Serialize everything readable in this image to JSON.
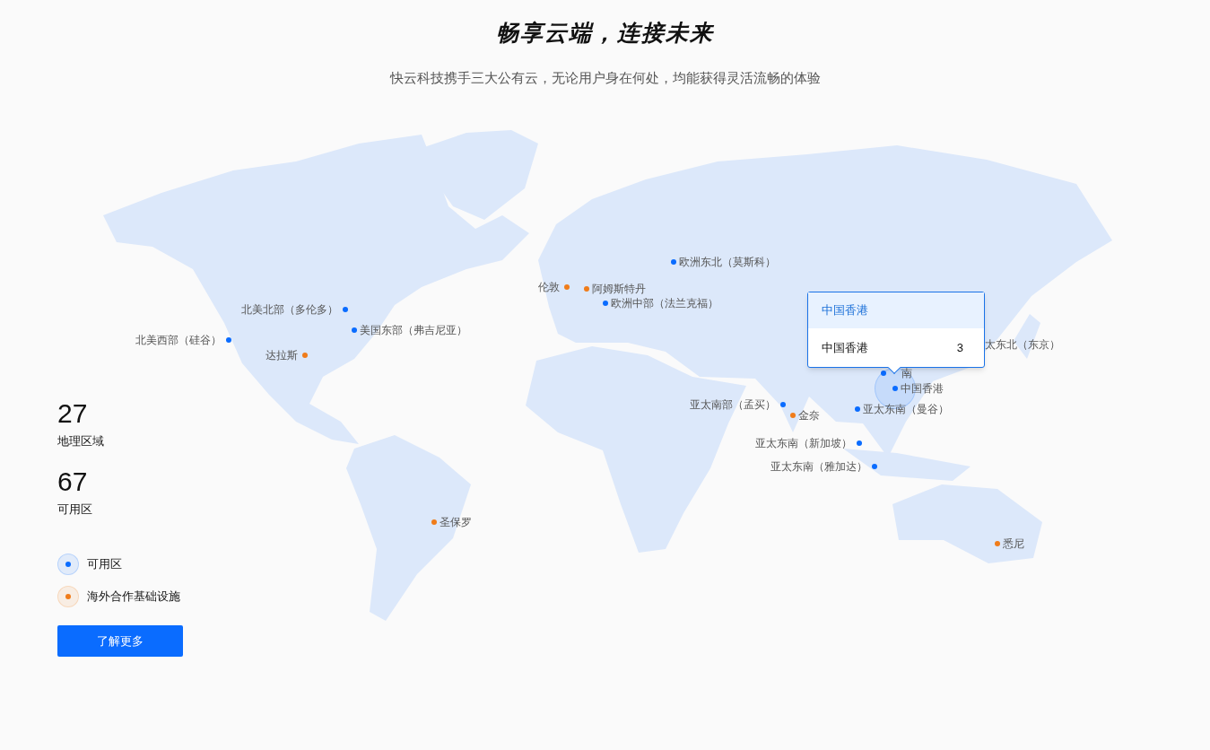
{
  "title": "畅享云端，连接未来",
  "subtitle": "快云科技携手三大公有云，无论用户身在何处，均能获得灵活流畅的体验",
  "stats": [
    {
      "value": "27",
      "label": "地理区域"
    },
    {
      "value": "67",
      "label": "可用区"
    }
  ],
  "legend": [
    {
      "label": "可用区",
      "color": "#0a6cff"
    },
    {
      "label": "海外合作基础设施",
      "color": "#f07c1a"
    }
  ],
  "button": "了解更多",
  "markers": [
    {
      "label": "欧洲东北（莫斯科）",
      "color": "#0a6cff"
    },
    {
      "label": "伦敦",
      "color": "#f07c1a"
    },
    {
      "label": "阿姆斯特丹",
      "color": "#f07c1a"
    },
    {
      "label": "欧洲中部（法兰克福）",
      "color": "#0a6cff"
    },
    {
      "label": "北美北部（多伦多）",
      "color": "#0a6cff"
    },
    {
      "label": "美国东部（弗吉尼亚）",
      "color": "#0a6cff"
    },
    {
      "label": "北美西部（硅谷）",
      "color": "#0a6cff"
    },
    {
      "label": "达拉斯",
      "color": "#f07c1a"
    },
    {
      "label": "太东北（东京）"
    },
    {
      "label": "南",
      "color": "#0a6cff"
    },
    {
      "label": "中国香港",
      "color": "#0a6cff",
      "selected": true
    },
    {
      "label": "亚太南部（孟买）",
      "color": "#0a6cff"
    },
    {
      "label": "金奈",
      "color": "#f07c1a"
    },
    {
      "label": "亚太东南（曼谷）",
      "color": "#0a6cff"
    },
    {
      "label": "亚太东南（新加坡）",
      "color": "#0a6cff"
    },
    {
      "label": "亚太东南（雅加达）",
      "color": "#0a6cff"
    },
    {
      "label": "圣保罗",
      "color": "#f07c1a"
    },
    {
      "label": "悉尼",
      "color": "#f07c1a"
    }
  ],
  "tooltip": {
    "title": "中国香港",
    "rows": [
      {
        "name": "中国香港",
        "count": "3"
      }
    ]
  }
}
